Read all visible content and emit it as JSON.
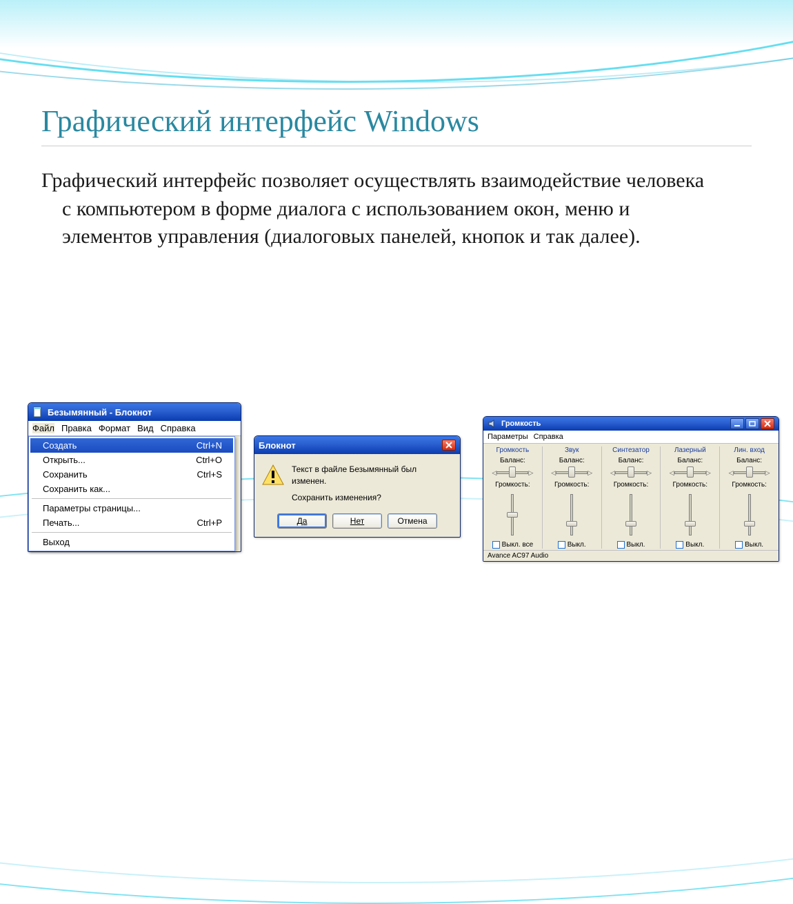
{
  "slide": {
    "title": "Графический интерфейс Windows",
    "body": "Графический интерфейс позволяет осуществлять взаимодействие человека с компьютером в форме диалога с использованием окон, меню и элементов управления (диалоговых панелей, кнопок и так далее)."
  },
  "notepad": {
    "title": "Безымянный - Блокнот",
    "menubar": [
      "Файл",
      "Правка",
      "Формат",
      "Вид",
      "Справка"
    ],
    "dropdown": [
      {
        "label": "Создать",
        "shortcut": "Ctrl+N",
        "active": true
      },
      {
        "label": "Открыть...",
        "shortcut": "Ctrl+O"
      },
      {
        "label": "Сохранить",
        "shortcut": "Ctrl+S"
      },
      {
        "label": "Сохранить как..."
      },
      {
        "sep": true
      },
      {
        "label": "Параметры страницы..."
      },
      {
        "label": "Печать...",
        "shortcut": "Ctrl+P"
      },
      {
        "sep": true
      },
      {
        "label": "Выход"
      }
    ]
  },
  "msgbox": {
    "title": "Блокнот",
    "line1": "Текст в файле Безымянный был изменен.",
    "line2": "Сохранить изменения?",
    "buttons": {
      "yes": "Да",
      "no": "Нет",
      "cancel": "Отмена"
    }
  },
  "mixer": {
    "title": "Громкость",
    "menubar": [
      "Параметры",
      "Справка"
    ],
    "labels": {
      "balance": "Баланс:",
      "volume": "Громкость:",
      "mute_all": "Выкл. все",
      "mute": "Выкл."
    },
    "channels": [
      {
        "name": "Громкость",
        "vol": 0.5,
        "mute_label": "mute_all"
      },
      {
        "name": "Звук",
        "vol": 0.25
      },
      {
        "name": "Синтезатор",
        "vol": 0.25
      },
      {
        "name": "Лазерный",
        "vol": 0.25
      },
      {
        "name": "Лин. вход",
        "vol": 0.25
      }
    ],
    "status": "Avance AC97 Audio"
  }
}
